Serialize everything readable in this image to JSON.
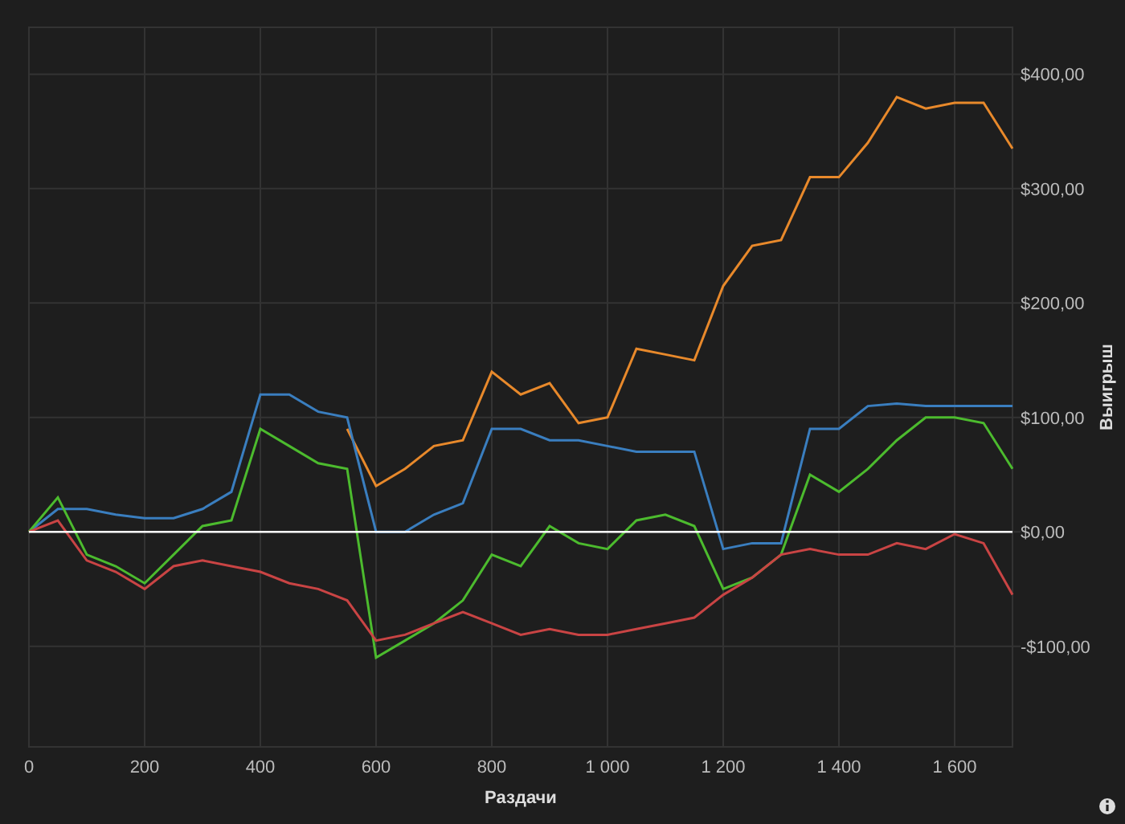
{
  "chart_data": {
    "type": "line",
    "xlabel": "Раздачи",
    "ylabel": "Выигрыш",
    "x": [
      0,
      50,
      100,
      150,
      200,
      250,
      300,
      350,
      400,
      450,
      500,
      550,
      600,
      650,
      700,
      750,
      800,
      850,
      900,
      950,
      1000,
      1050,
      1100,
      1150,
      1200,
      1250,
      1300,
      1350,
      1400,
      1450,
      1500,
      1550,
      1600,
      1650,
      1700
    ],
    "series": [
      {
        "color": "#e8892b",
        "values": [
          null,
          null,
          null,
          null,
          null,
          null,
          null,
          null,
          null,
          null,
          null,
          90,
          40,
          55,
          75,
          80,
          140,
          120,
          130,
          95,
          100,
          160,
          155,
          150,
          215,
          250,
          255,
          310,
          310,
          340,
          380,
          370,
          375,
          375,
          335
        ]
      },
      {
        "color": "#3a7ebf",
        "values": [
          0,
          20,
          20,
          15,
          12,
          12,
          20,
          35,
          120,
          120,
          105,
          100,
          0,
          0,
          15,
          25,
          90,
          90,
          80,
          80,
          75,
          70,
          70,
          70,
          -15,
          -10,
          -10,
          90,
          90,
          110,
          112,
          110,
          110,
          110,
          110
        ]
      },
      {
        "color": "#4cbb2e",
        "values": [
          0,
          30,
          -20,
          -30,
          -45,
          -20,
          5,
          10,
          90,
          75,
          60,
          55,
          -110,
          -95,
          -80,
          -60,
          -20,
          -30,
          5,
          -10,
          -15,
          10,
          15,
          5,
          -50,
          -40,
          -20,
          50,
          35,
          55,
          80,
          100,
          100,
          95,
          55
        ]
      },
      {
        "color": "#c94444",
        "values": [
          0,
          10,
          -25,
          -35,
          -50,
          -30,
          -25,
          -30,
          -35,
          -45,
          -50,
          -60,
          -95,
          -90,
          -80,
          -70,
          -80,
          -90,
          -85,
          -90,
          -90,
          -85,
          -80,
          -75,
          -55,
          -40,
          -20,
          -15,
          -20,
          -20,
          -10,
          -15,
          -2,
          -10,
          -55
        ]
      }
    ],
    "xlim": [
      0,
      1700
    ],
    "ylim": [
      -188,
      441
    ],
    "xticks": [
      {
        "value": 0,
        "label": "0"
      },
      {
        "value": 200,
        "label": "200"
      },
      {
        "value": 400,
        "label": "400"
      },
      {
        "value": 600,
        "label": "600"
      },
      {
        "value": 800,
        "label": "800"
      },
      {
        "value": 1000,
        "label": "1 000"
      },
      {
        "value": 1200,
        "label": "1 200"
      },
      {
        "value": 1400,
        "label": "1 400"
      },
      {
        "value": 1600,
        "label": "1 600"
      }
    ],
    "yticks": [
      {
        "value": -100,
        "label": "-$100,00"
      },
      {
        "value": 0,
        "label": "$0,00"
      },
      {
        "value": 100,
        "label": "$100,00"
      },
      {
        "value": 200,
        "label": "$200,00"
      },
      {
        "value": 300,
        "label": "$300,00"
      },
      {
        "value": 400,
        "label": "$400,00"
      }
    ],
    "grid": true,
    "ref_lines": [
      {
        "axis": "y",
        "value": 0,
        "color": "#ffffff"
      }
    ]
  }
}
